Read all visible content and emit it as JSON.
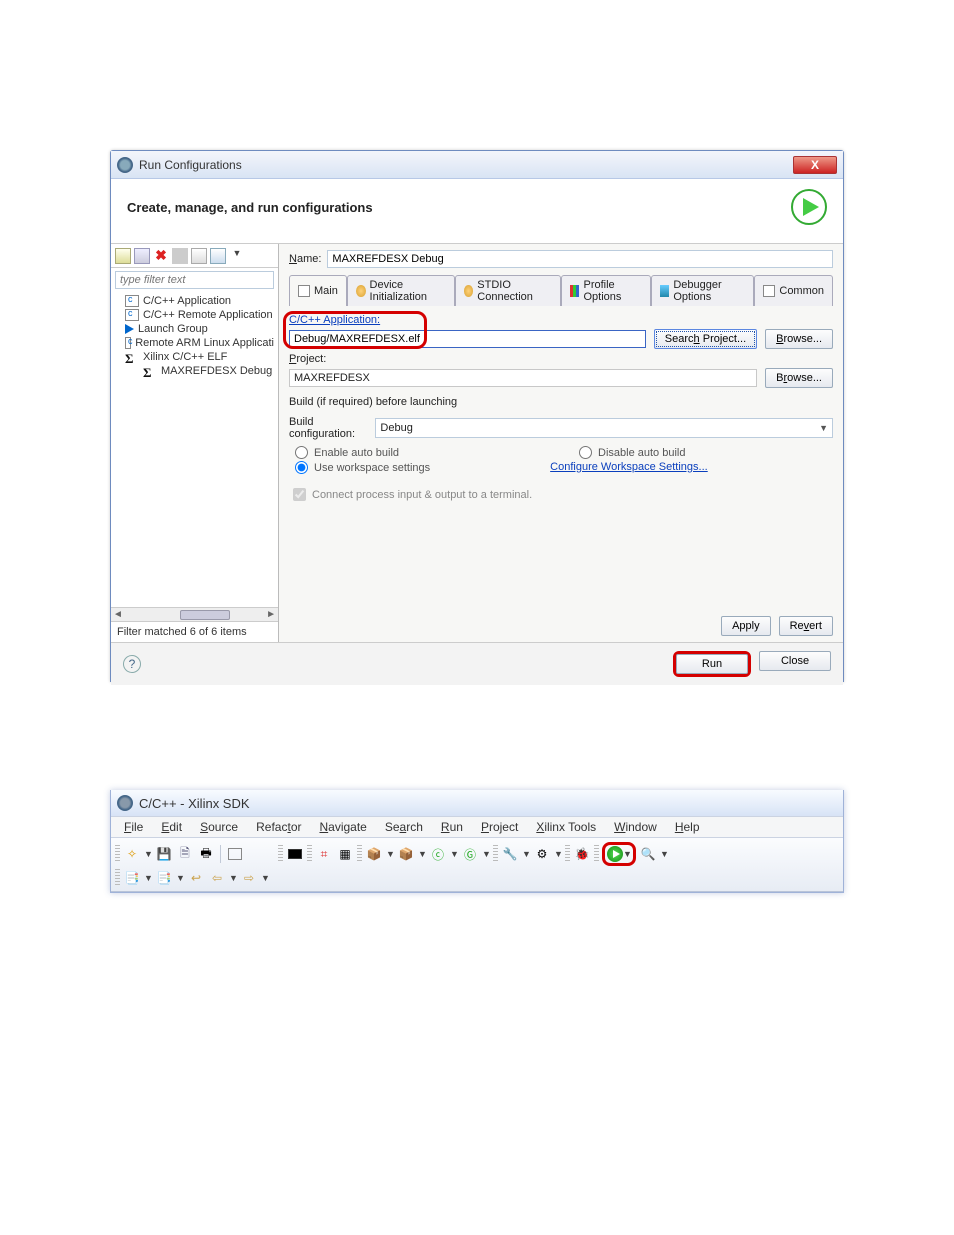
{
  "dialog": {
    "title": "Run Configurations",
    "subtitle": "Create, manage, and run configurations",
    "filter_placeholder": "type filter text",
    "tree": [
      {
        "label": "C/C++ Application",
        "icon": "c"
      },
      {
        "label": "C/C++ Remote Application",
        "icon": "c"
      },
      {
        "label": "Launch Group",
        "icon": "pl"
      },
      {
        "label": "Remote ARM Linux Applicati",
        "icon": "c"
      },
      {
        "label": "Xilinx C/C++ ELF",
        "icon": "sig"
      },
      {
        "label": "MAXREFDESX Debug",
        "icon": "sig",
        "sub": true
      }
    ],
    "filter_count": "Filter matched 6 of 6 items",
    "name_label": "Name:",
    "name_value": "MAXREFDESX Debug",
    "tabs": {
      "main": "Main",
      "devinit": "Device Initialization",
      "stdio": "STDIO Connection",
      "profile": "Profile Options",
      "debugger": "Debugger Options",
      "common": "Common"
    },
    "app_label": "C/C++ Application:",
    "app_value": "Debug/MAXREFDESX.elf",
    "search_project": "Search Project...",
    "browse": "Browse...",
    "project_label": "Project:",
    "project_value": "MAXREFDESX",
    "build_heading": "Build (if required) before launching",
    "build_conf_label": "Build configuration:",
    "build_conf_value": "Debug",
    "enable_auto": "Enable auto build",
    "disable_auto": "Disable auto build",
    "use_ws": "Use workspace settings",
    "config_ws": "Configure Workspace Settings...",
    "connect_proc": "Connect process input & output to a terminal.",
    "apply": "Apply",
    "revert": "Revert",
    "run": "Run",
    "close": "Close"
  },
  "sdk": {
    "title": "C/C++ - Xilinx SDK",
    "menu": {
      "file": "File",
      "edit": "Edit",
      "source": "Source",
      "refactor": "Refactor",
      "navigate": "Navigate",
      "search": "Search",
      "run": "Run",
      "project": "Project",
      "xtools": "Xilinx Tools",
      "window": "Window",
      "help": "Help"
    }
  }
}
